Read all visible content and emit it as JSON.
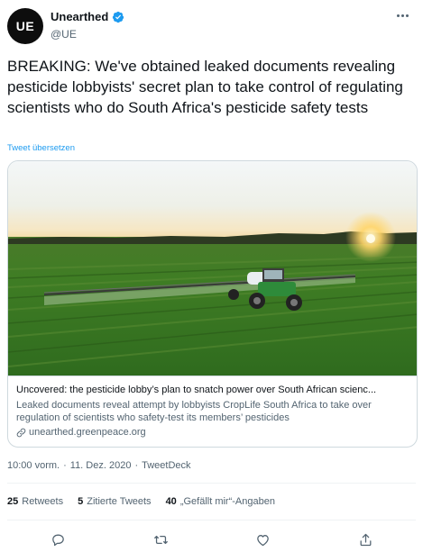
{
  "author": {
    "avatar_text": "UE",
    "name": "Unearthed",
    "handle": "@UE",
    "verified": true
  },
  "tweet": {
    "text": "BREAKING: We've obtained leaked documents revealing pesticide lobbyists' secret plan to take control of regulating scientists who do South Africa's pesticide safety tests",
    "translate_label": "Tweet übersetzen"
  },
  "card": {
    "image_icon": "tractor-spraying-field-photo",
    "title": "Uncovered: the pesticide lobby’s plan to snatch power over South African scienc...",
    "description": "Leaked documents reveal attempt by lobbyists CropLife South Africa to take over regulation of scientists who safety-test its members’ pesticides",
    "domain": "unearthed.greenpeace.org"
  },
  "meta": {
    "time": "10:00 vorm.",
    "separator": "·",
    "date": "11. Dez. 2020",
    "source": "TweetDeck"
  },
  "stats": {
    "retweets_count": "25",
    "retweets_label": "Retweets",
    "quotes_count": "5",
    "quotes_label": "Zitierte Tweets",
    "likes_count": "40",
    "likes_label": "„Gefällt mir“-Angaben"
  },
  "colors": {
    "accent": "#1d9bf0",
    "text_secondary": "#536471",
    "border": "#cfd9de"
  },
  "icons": [
    "verified-badge-icon",
    "more-options-icon",
    "link-icon",
    "reply-icon",
    "retweet-icon",
    "like-icon",
    "share-icon"
  ]
}
